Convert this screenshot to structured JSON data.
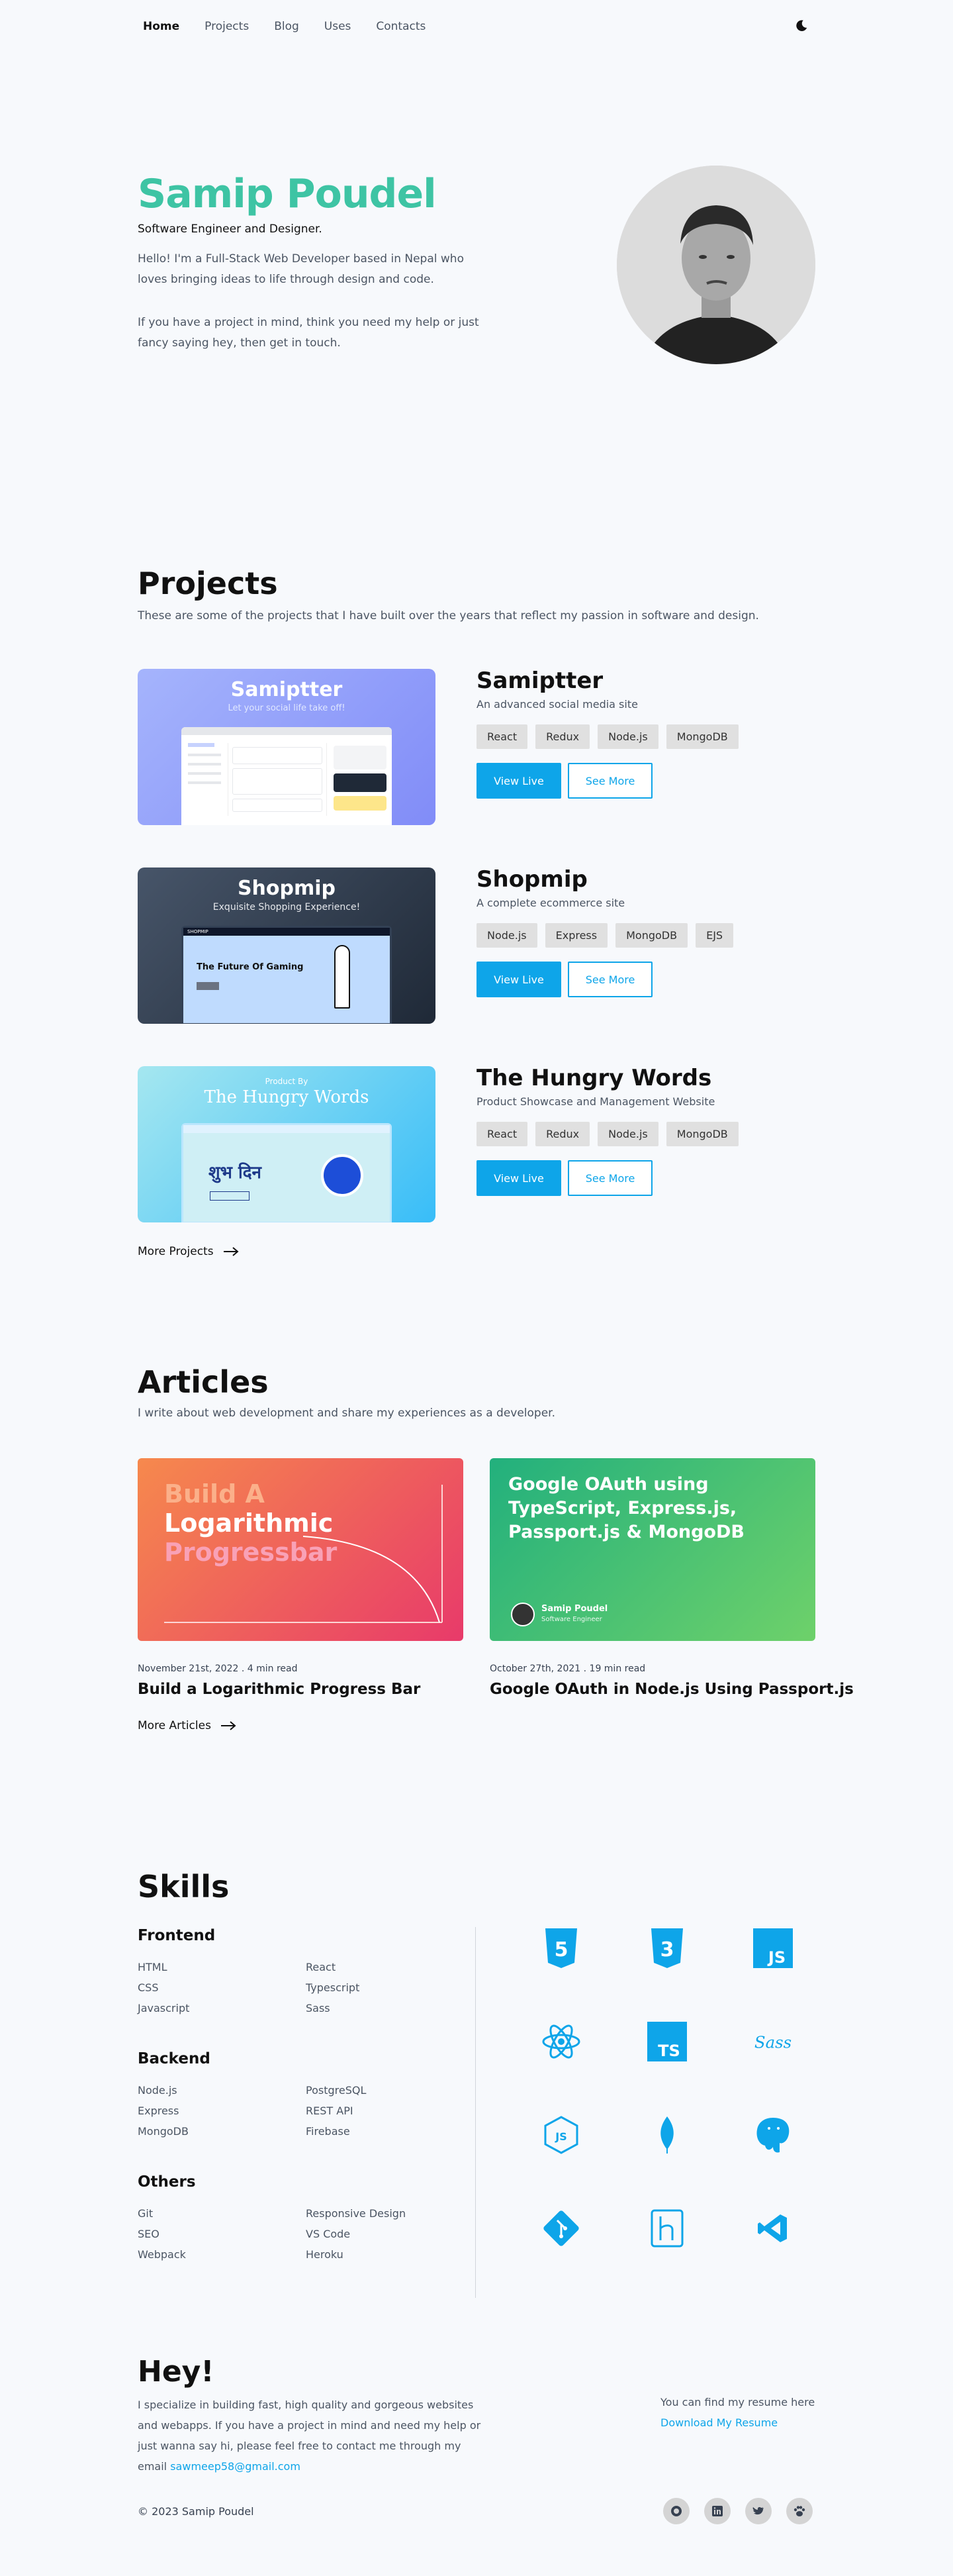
{
  "nav": {
    "items": [
      "Home",
      "Projects",
      "Blog",
      "Uses",
      "Contacts"
    ],
    "active": "Home",
    "theme_icon": "moon-icon"
  },
  "hero": {
    "name": "Samip Poudel",
    "role": "Software Engineer and Designer.",
    "p1": "Hello! I'm a Full-Stack Web Developer based in Nepal who loves bringing ideas to life through design and code.",
    "p2": "If you have a project in mind, think you need my help or just fancy saying hey, then get in touch.",
    "colors": {
      "accent": "#3ec4a4"
    }
  },
  "projects": {
    "title": "Projects",
    "subtitle": "These are some of the projects that I have built over the years that reflect my passion in software and design.",
    "items": [
      {
        "name": "Samiptter",
        "desc": "An advanced social media site",
        "tags": [
          "React",
          "Redux",
          "Node.js",
          "MongoDB"
        ],
        "live": "View Live",
        "more": "See More",
        "banner_title": "Samiptter",
        "banner_sub": "Let your social life take off!"
      },
      {
        "name": "Shopmip",
        "desc": "A complete ecommerce site",
        "tags": [
          "Node.js",
          "Express",
          "MongoDB",
          "EJS"
        ],
        "live": "View Live",
        "more": "See More",
        "banner_title": "Shopmip",
        "banner_sub": "Exquisite Shopping Experience!",
        "shot_heading": "The Future Of Gaming",
        "shot_brand": "SHOPMIP"
      },
      {
        "name": "The Hungry Words",
        "desc": "Product Showcase and Management Website",
        "tags": [
          "React",
          "Redux",
          "Node.js",
          "MongoDB"
        ],
        "live": "View Live",
        "more": "See More",
        "banner_pre": "Product By",
        "banner_title": "The Hungry Words",
        "shot_heading": "शुभ दिन"
      }
    ],
    "more": "More Projects"
  },
  "articles": {
    "title": "Articles",
    "subtitle": "I write about web development and share my experiences as a developer.",
    "items": [
      {
        "img_lines": [
          "Build A",
          "Logarithmic",
          "Progressbar"
        ],
        "meta": "November 21st, 2022 . 4 min read",
        "title": "Build a Logarithmic Progress Bar"
      },
      {
        "img_lines": [
          "Google OAuth using",
          "TypeScript, Express.js,",
          "Passport.js &  MongoDB"
        ],
        "author": "Samip Poudel",
        "author_role": "Software Engineer",
        "meta": "October 27th, 2021 . 19 min read",
        "title": "Google OAuth in Node.js Using Passport.js"
      }
    ],
    "more": "More Articles"
  },
  "skills": {
    "title": "Skills",
    "groups": [
      {
        "name": "Frontend",
        "col1": [
          "HTML",
          "CSS",
          "Javascript"
        ],
        "col2": [
          "React",
          "Typescript",
          "Sass"
        ]
      },
      {
        "name": "Backend",
        "col1": [
          "Node.js",
          "Express",
          "MongoDB"
        ],
        "col2": [
          "PostgreSQL",
          "REST API",
          "Firebase"
        ]
      },
      {
        "name": "Others",
        "col1": [
          "Git",
          "SEO",
          "Webpack"
        ],
        "col2": [
          "Responsive Design",
          "VS Code",
          "Heroku"
        ]
      }
    ],
    "icons": [
      "html5-icon",
      "css3-icon",
      "javascript-icon",
      "react-icon",
      "typescript-icon",
      "sass-icon",
      "nodejs-icon",
      "mongodb-icon",
      "postgresql-icon",
      "git-icon",
      "heroku-icon",
      "vscode-icon"
    ],
    "icon_color": "#0ea5e9"
  },
  "footer": {
    "hey": "Hey!",
    "text": "I specialize in building fast, high quality and gorgeous websites and webapps. If you have a project in mind and need my help or just wanna say hi, please feel free to contact me through my email",
    "email": "sawmeep58@gmail.com",
    "resume_label": "You can find my resume here",
    "resume_link": "Download My Resume",
    "copyright": "© 2023 Samip Poudel",
    "social": [
      "github-icon",
      "linkedin-icon",
      "twitter-icon",
      "paw-icon"
    ]
  }
}
